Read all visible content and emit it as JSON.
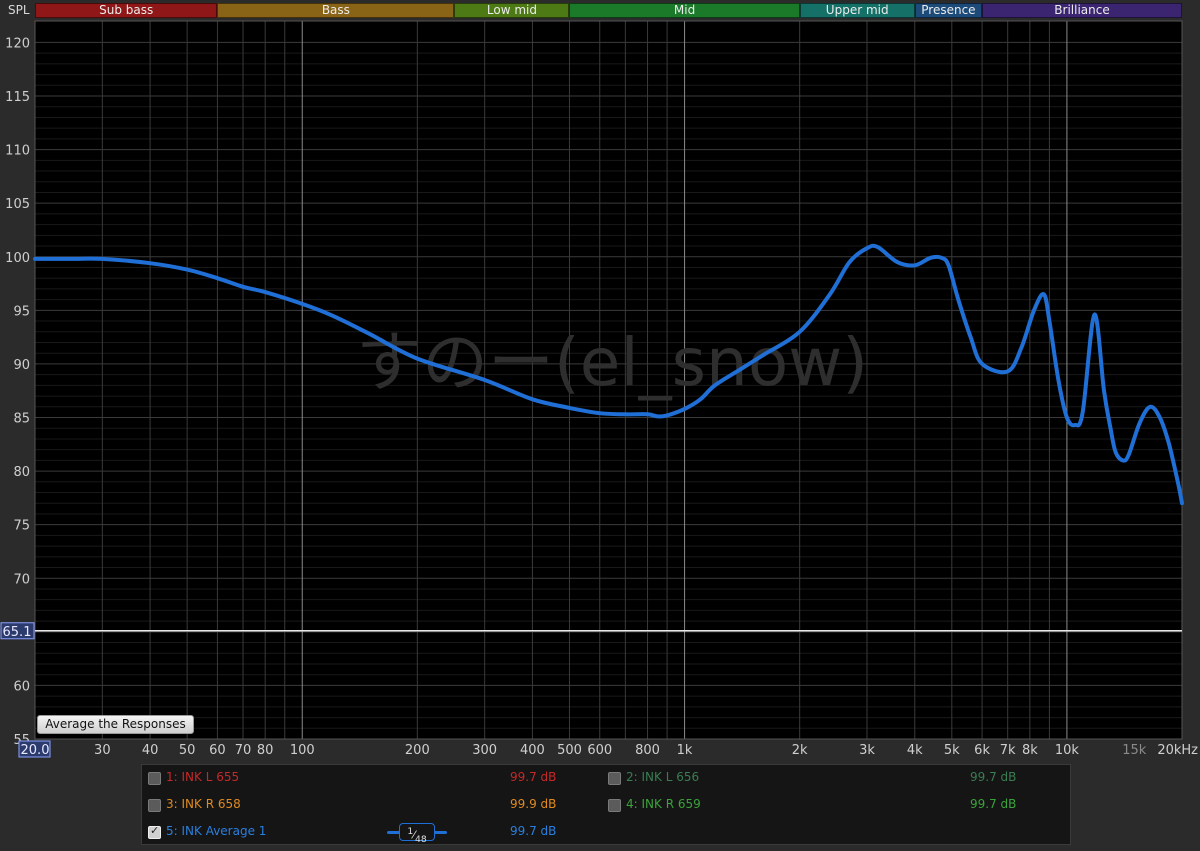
{
  "bands": [
    {
      "label": "Sub bass",
      "from": 20,
      "to": 60,
      "color": "#8f1717"
    },
    {
      "label": "Bass",
      "from": 60,
      "to": 250,
      "color": "#8a6416"
    },
    {
      "label": "Low mid",
      "from": 250,
      "to": 500,
      "color": "#4e7a16"
    },
    {
      "label": "Mid",
      "from": 500,
      "to": 2000,
      "color": "#1a7a2a"
    },
    {
      "label": "Upper mid",
      "from": 2000,
      "to": 4000,
      "color": "#157068"
    },
    {
      "label": "Presence",
      "from": 4000,
      "to": 6000,
      "color": "#1c4b7a"
    },
    {
      "label": "Brilliance",
      "from": 6000,
      "to": 20000,
      "color": "#3b2470"
    }
  ],
  "axis": {
    "y_title": "SPL",
    "x_min_label": "20.0",
    "cursor_label": "65.1",
    "y_tick_labels": [
      "120",
      "115",
      "110",
      "105",
      "100",
      "95",
      "90",
      "85",
      "80",
      "75",
      "70",
      "65",
      "60",
      "55"
    ],
    "x_tick_labels": [
      "30",
      "40",
      "50",
      "60",
      "70",
      "80",
      "100",
      "200",
      "300",
      "400",
      "500",
      "600",
      "800",
      "1k",
      "2k",
      "3k",
      "4k",
      "5k",
      "6k",
      "7k",
      "8k",
      "10k",
      "15k",
      "20kHz"
    ]
  },
  "buttons": {
    "average": "Average the Responses"
  },
  "legend": {
    "items": [
      {
        "name": "1: INK L 655",
        "value": "99.7 dB",
        "color": "#c62828",
        "checked": false
      },
      {
        "name": "2: INK L 656",
        "value": "99.7 dB",
        "color": "#3a7d52",
        "checked": false
      },
      {
        "name": "3: INK R 658",
        "value": "99.9 dB",
        "color": "#e08a1e",
        "checked": false
      },
      {
        "name": "4: INK R 659",
        "value": "99.7 dB",
        "color": "#3aa33a",
        "checked": false
      },
      {
        "name": "5: INK Average 1",
        "value": "99.7 dB",
        "color": "#2a7fe0",
        "checked": true
      }
    ],
    "smoothing_num": "1",
    "smoothing_den": "48"
  },
  "chart_data": {
    "type": "line",
    "title": "",
    "xlabel": "",
    "ylabel": "SPL",
    "x_scale": "log",
    "xlim": [
      20,
      20000
    ],
    "ylim": [
      55,
      122
    ],
    "cursor_y": 65.1,
    "grid": true,
    "series": [
      {
        "name": "5: INK Average 1",
        "color": "#1f6fd6",
        "x": [
          20,
          25,
          30,
          40,
          50,
          60,
          70,
          80,
          100,
          120,
          150,
          200,
          300,
          400,
          500,
          600,
          700,
          800,
          850,
          900,
          1000,
          1100,
          1200,
          1400,
          1600,
          2000,
          2400,
          2700,
          3000,
          3200,
          3600,
          4000,
          4400,
          4700,
          4900,
          5200,
          5600,
          6000,
          7000,
          7600,
          8200,
          8700,
          9000,
          9500,
          10000,
          10500,
          11000,
          11800,
          12500,
          13000,
          13400,
          14000,
          14500,
          15500,
          16500,
          17500,
          18500,
          19500,
          20000
        ],
        "y": [
          99.8,
          99.8,
          99.8,
          99.4,
          98.8,
          98.0,
          97.2,
          96.7,
          95.6,
          94.5,
          92.8,
          90.5,
          88.5,
          86.7,
          85.9,
          85.4,
          85.3,
          85.3,
          85.1,
          85.2,
          85.8,
          86.7,
          88.0,
          89.5,
          90.8,
          93.0,
          96.5,
          99.5,
          100.8,
          100.9,
          99.5,
          99.2,
          99.9,
          99.9,
          99.2,
          96.0,
          92.5,
          90.0,
          89.3,
          91.5,
          95.0,
          96.5,
          94.0,
          88.5,
          85.0,
          84.3,
          85.5,
          94.6,
          87.5,
          84.0,
          81.8,
          81.0,
          81.5,
          84.5,
          86.0,
          85.0,
          82.5,
          79.0,
          77.0
        ]
      }
    ],
    "watermark": "すのー(el_snow)"
  }
}
